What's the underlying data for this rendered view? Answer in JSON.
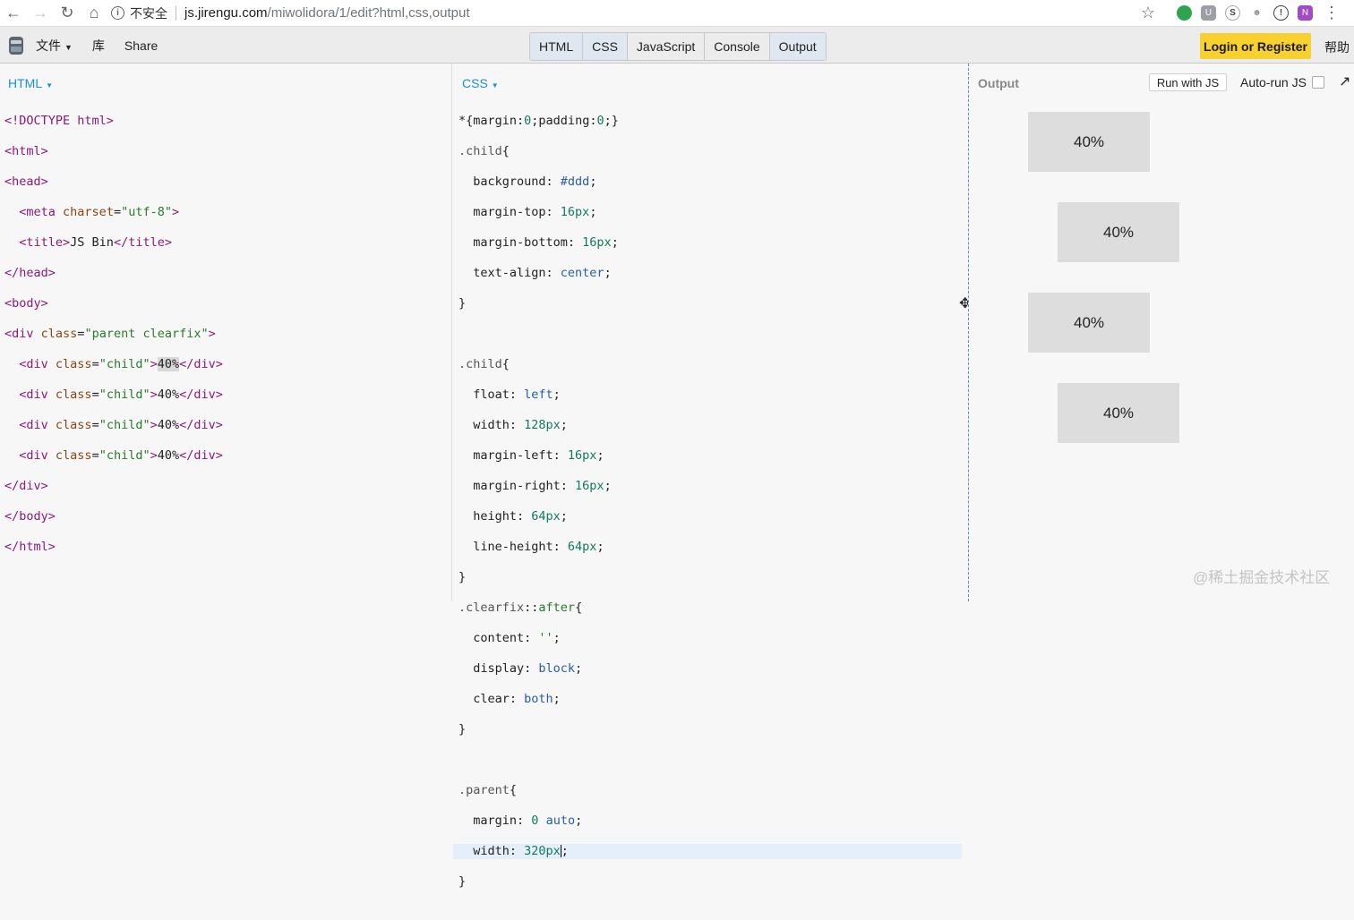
{
  "browser": {
    "security_label": "不安全",
    "url_host": "js.jirengu.com",
    "url_path": "/miwolidora/1/edit?html,css,output",
    "icons": [
      "back-icon",
      "forward-icon",
      "reload-icon",
      "home-icon",
      "info-icon",
      "star-icon",
      "more-icon"
    ]
  },
  "toolbar": {
    "file_menu": "文件",
    "library": "库",
    "share": "Share",
    "tabs": [
      {
        "label": "HTML",
        "active": true
      },
      {
        "label": "CSS",
        "active": true
      },
      {
        "label": "JavaScript",
        "active": false
      },
      {
        "label": "Console",
        "active": false
      },
      {
        "label": "Output",
        "active": true
      }
    ],
    "login": "Login or Register",
    "help": "帮助"
  },
  "html_panel": {
    "label": "HTML"
  },
  "css_panel": {
    "label": "CSS"
  },
  "output_panel": {
    "title": "Output",
    "run_button": "Run with JS",
    "autorun_label": "Auto-run JS",
    "autorun_checked": false,
    "children": [
      "40%",
      "40%",
      "40%",
      "40%"
    ]
  },
  "watermark": "@稀土掘金技术社区",
  "colors": {
    "accent": "#1a8fd6",
    "login_bg": "#f8d12f",
    "child_bg": "#dddddd"
  }
}
